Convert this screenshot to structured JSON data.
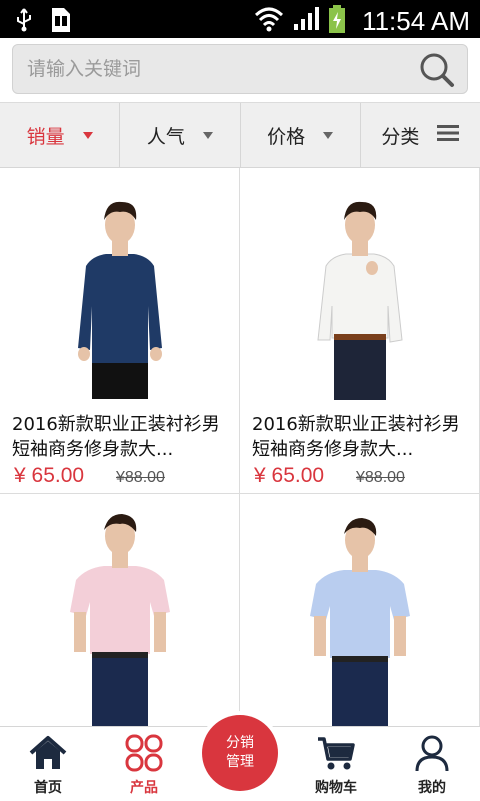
{
  "status_bar": {
    "time": "11:54 AM"
  },
  "search": {
    "placeholder": "请输入关键词"
  },
  "sort_tabs": [
    {
      "label": "销量",
      "active": true
    },
    {
      "label": "人气",
      "active": false
    },
    {
      "label": "价格",
      "active": false
    },
    {
      "label": "分类",
      "active": false
    }
  ],
  "products": [
    {
      "title": "2016新款职业正装衬衫男短袖商务修身款大...",
      "price": "¥  65.00",
      "original_price": "¥88.00",
      "shirt_color": "#1f3a66"
    },
    {
      "title": "2016新款职业正装衬衫男短袖商务修身款大...",
      "price": "¥  65.00",
      "original_price": "¥88.00",
      "shirt_color": "#f4f4f2"
    },
    {
      "title": "",
      "price": "",
      "original_price": "",
      "shirt_color": "#f3cfd8"
    },
    {
      "title": "",
      "price": "",
      "original_price": "",
      "shirt_color": "#b9cdef"
    }
  ],
  "bottom_nav": {
    "home": "首页",
    "products": "产品",
    "center_line1": "分销",
    "center_line2": "管理",
    "cart": "购物车",
    "mine": "我的"
  },
  "colors": {
    "accent": "#d9363e"
  }
}
